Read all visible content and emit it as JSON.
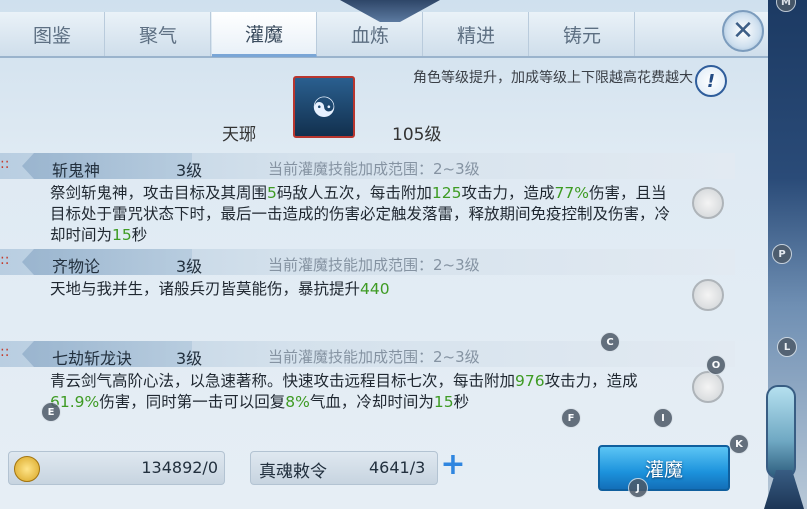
{
  "tabs": [
    "图鉴",
    "聚气",
    "灌魔",
    "血炼",
    "精进",
    "铸元"
  ],
  "active_tab": "灌魔",
  "header": {
    "notice": "角色等级提升，加成等级上下限越高花费越大",
    "help": "!",
    "character_name": "天琊",
    "character_level": "105级"
  },
  "skills": [
    {
      "name": "斩鬼神",
      "level": "3级",
      "range": "当前灌魔技能加成范围：2~3级",
      "desc": [
        {
          "t": "祭剑斩鬼神，攻击目标及其周围"
        },
        {
          "t": "5",
          "g": true
        },
        {
          "t": "码敌人五次，每击附加"
        },
        {
          "t": "125",
          "g": true
        },
        {
          "t": "攻击力，造成"
        },
        {
          "t": "77%",
          "g": true
        },
        {
          "t": "伤害，且当目标处于雷咒状态下时，最后一击造成的伤害必定触发落雷，释放期间免疫控制及伤害，冷却时间为"
        },
        {
          "t": "15",
          "g": true
        },
        {
          "t": "秒"
        }
      ]
    },
    {
      "name": "齐物论",
      "level": "3级",
      "range": "当前灌魔技能加成范围：2~3级",
      "desc": [
        {
          "t": "天地与我并生，诸般兵刃皆莫能伤，暴抗提升"
        },
        {
          "t": "440",
          "g": true
        }
      ]
    },
    {
      "name": "七劫斩龙诀",
      "level": "3级",
      "range": "当前灌魔技能加成范围：2~3级",
      "desc": [
        {
          "t": "青云剑气高阶心法，以急速著称。快速攻击远程目标七次，每击附加"
        },
        {
          "t": "976",
          "g": true
        },
        {
          "t": "攻击力，造成"
        },
        {
          "t": "61.9%",
          "g": true
        },
        {
          "t": "伤害，同时第一击可以回复"
        },
        {
          "t": "8%",
          "g": true
        },
        {
          "t": "气血，冷却时间为"
        },
        {
          "t": "15",
          "g": true
        },
        {
          "t": "秒"
        }
      ]
    }
  ],
  "footer": {
    "coins": "134892/0",
    "token_label": "真魂敕令",
    "token_value": "4641/3",
    "plus": "+",
    "action_button": "灌魔"
  },
  "key_hints": [
    "M",
    "P",
    "L",
    "C",
    "O",
    "E",
    "F",
    "I",
    "K",
    "J"
  ],
  "colors": {
    "highlight": "#3e9b23",
    "accent": "#1c92dc"
  }
}
